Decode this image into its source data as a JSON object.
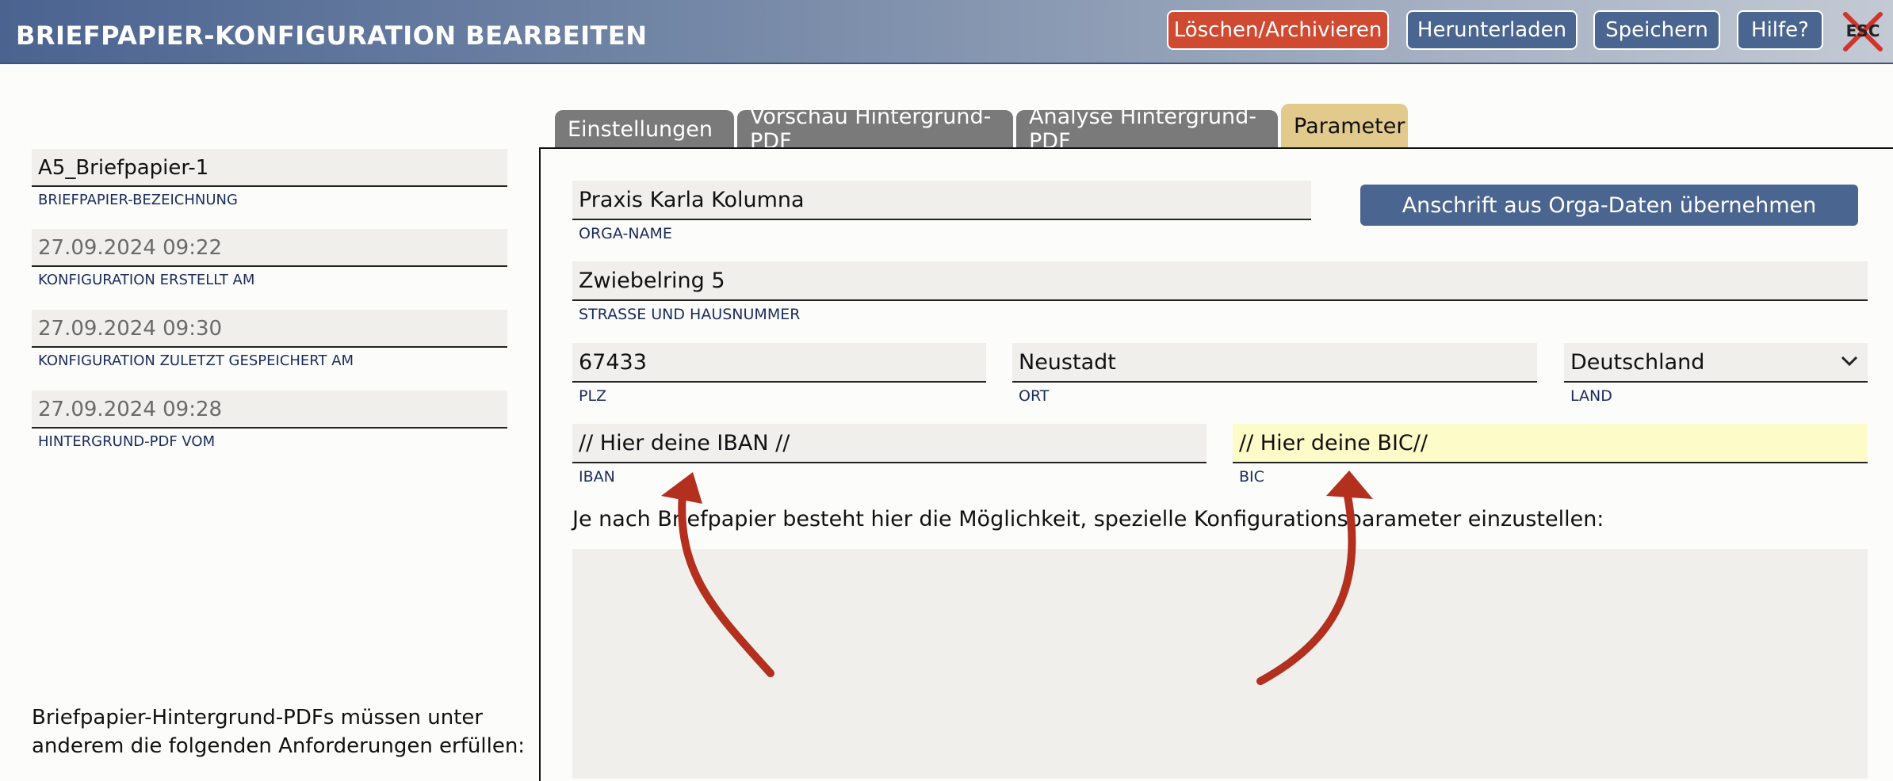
{
  "header": {
    "title": "BRIEFPAPIER-KONFIGURATION BEARBEITEN",
    "buttons": {
      "delete": "Löschen/Archivieren",
      "download": "Herunterladen",
      "save": "Speichern",
      "help": "Hilfe?",
      "esc": "ESC"
    }
  },
  "left": {
    "fields": [
      {
        "value": "A5_Briefpapier-1",
        "label": "BRIEFPAPIER-BEZEICHNUNG"
      },
      {
        "value": "27.09.2024 09:22",
        "label": "KONFIGURATION ERSTELLT AM"
      },
      {
        "value": "27.09.2024 09:30",
        "label": "KONFIGURATION ZULETZT GESPEICHERT AM"
      },
      {
        "value": "27.09.2024 09:28",
        "label": "HINTERGRUND-PDF VOM"
      }
    ],
    "requirements_line1": "Briefpapier-Hintergrund-PDFs müssen unter",
    "requirements_line2": "anderem die folgenden Anforderungen erfüllen:"
  },
  "tabs": {
    "settings": "Einstellungen",
    "preview": "Vorschau Hintergrund-PDF",
    "analysis": "Analyse Hintergrund-PDF",
    "parameters": "Parameter"
  },
  "form": {
    "orga_name": {
      "value": "Praxis Karla Kolumna",
      "label": "ORGA-NAME"
    },
    "orga_button": "Anschrift aus Orga-Daten übernehmen",
    "street": {
      "value": "Zwiebelring 5",
      "label": "STRASSE UND HAUSNUMMER"
    },
    "zip": {
      "value": "67433",
      "label": "PLZ"
    },
    "city": {
      "value": "Neustadt",
      "label": "ORT"
    },
    "country": {
      "value": "Deutschland",
      "label": "LAND"
    },
    "iban": {
      "value": "// Hier deine IBAN //",
      "label": "IBAN"
    },
    "bic": {
      "value": "// Hier deine BIC//",
      "label": "BIC"
    },
    "info": "Je nach Briefpapier besteht hier die Möglichkeit, spezielle Konfigurationsparameter einzustellen:"
  },
  "colors": {
    "header_start": "#4a6390",
    "button_blue": "#4a6590",
    "button_danger": "#d04a32",
    "active_tab": "#e2c98c",
    "highlight_yellow": "#fdfbc8",
    "annotation_arrow": "#b3301e"
  }
}
